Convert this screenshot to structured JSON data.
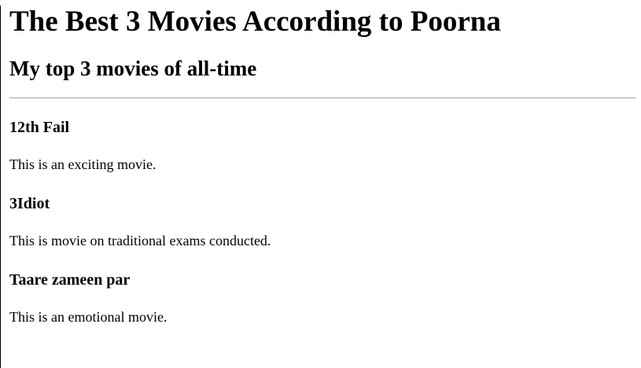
{
  "page": {
    "title": "The Best 3 Movies According to Poorna",
    "subtitle": "My top 3 movies of all-time"
  },
  "movies": [
    {
      "name": "12th Fail",
      "description": "This is an exciting movie."
    },
    {
      "name": "3Idiot",
      "description": "This is movie on traditional exams conducted."
    },
    {
      "name": "Taare zameen par",
      "description": "This is an emotional movie."
    }
  ]
}
